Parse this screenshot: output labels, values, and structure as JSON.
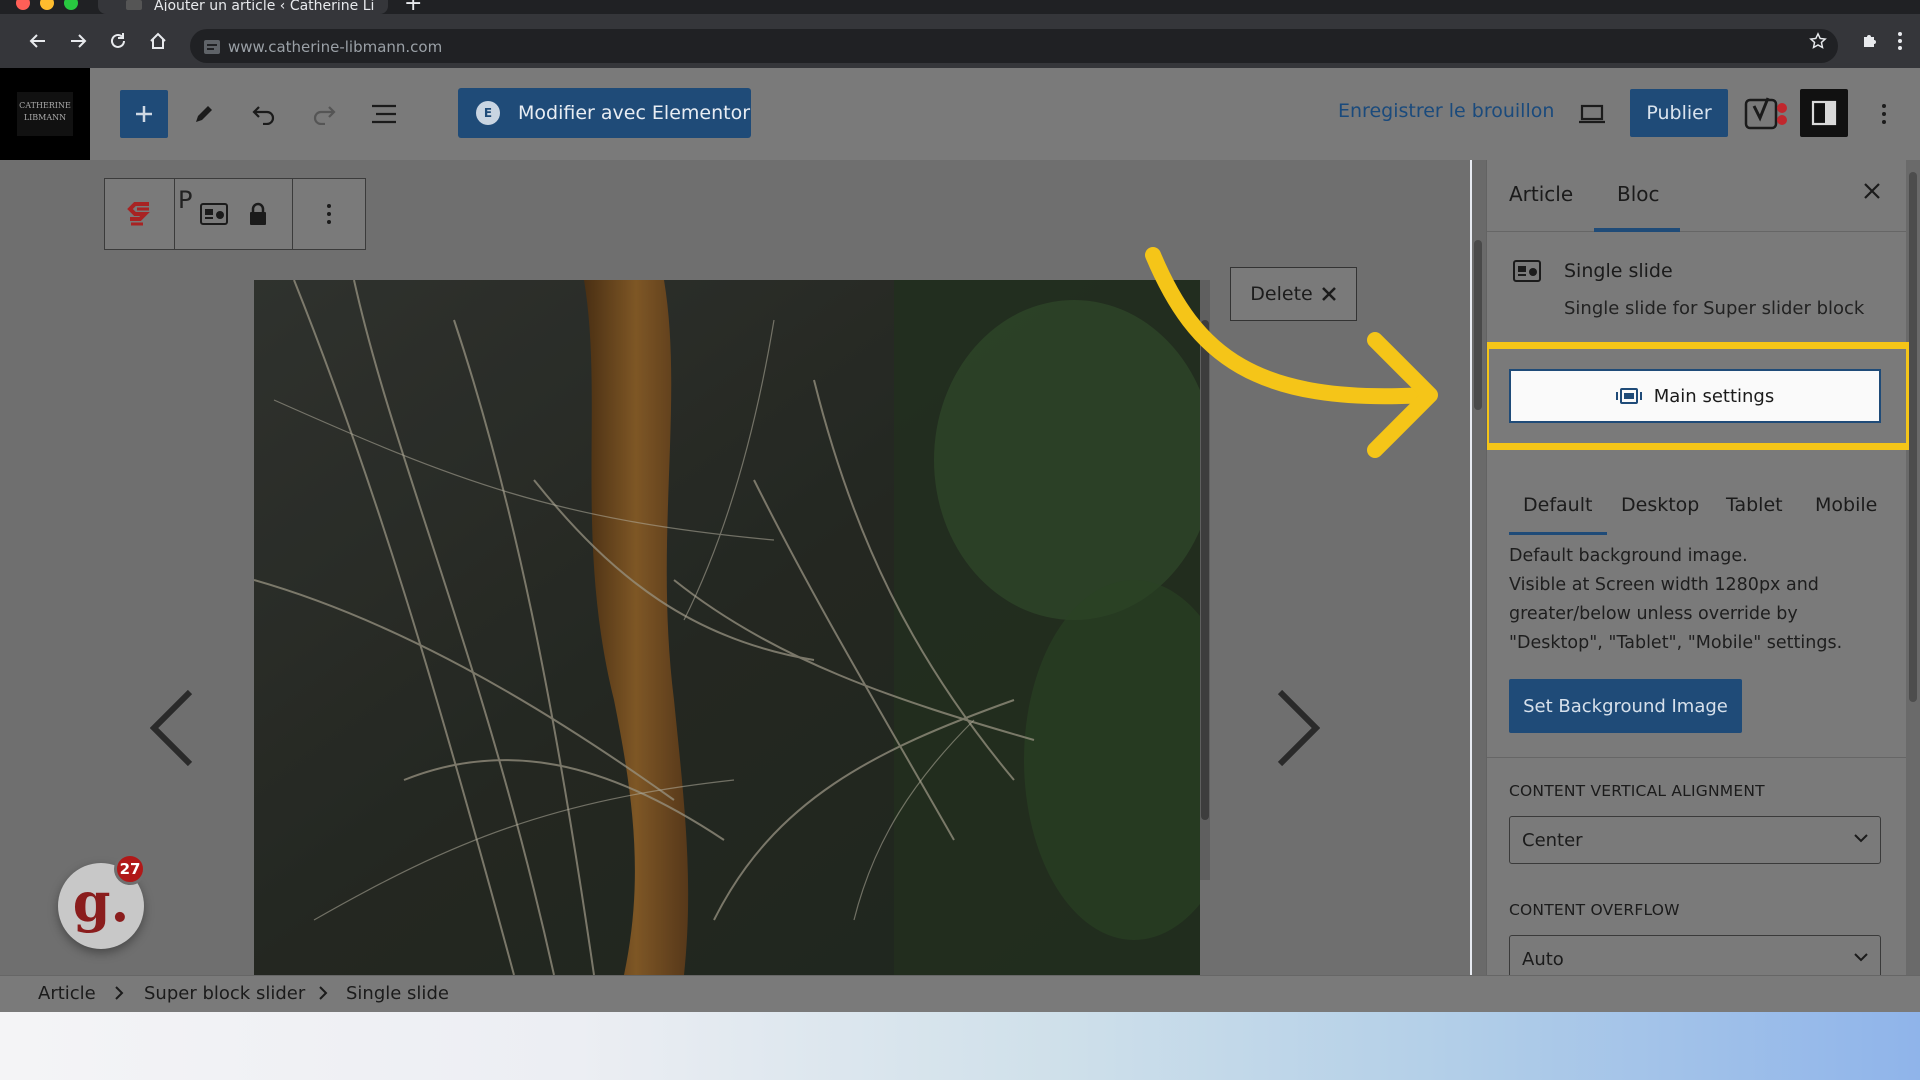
{
  "browser": {
    "tab_title": "Ajouter un article ‹ Catherine Libm",
    "url": "www.catherine-libmann.com"
  },
  "site_logo": {
    "line1": "CATHERINE",
    "line2": "LIBMANN"
  },
  "editor_toolbar": {
    "elementor_label": "Modifier avec Elementor",
    "elementor_badge": "E",
    "save_draft_label": "Enregistrer le brouillon",
    "publish_label": "Publier"
  },
  "block_toolbar": {
    "paragraph_letter": "P"
  },
  "canvas": {
    "delete_label": "Delete"
  },
  "notification_badge": {
    "letter": "g.",
    "count": "27"
  },
  "sidebar": {
    "tabs": [
      {
        "label": "Article"
      },
      {
        "label": "Bloc"
      }
    ],
    "active_tab": "Bloc",
    "block_title": "Single slide",
    "block_description": "Single slide for Super slider block",
    "main_settings_label": "Main settings",
    "responsive_tabs": [
      {
        "label": "Default"
      },
      {
        "label": "Desktop"
      },
      {
        "label": "Tablet"
      },
      {
        "label": "Mobile"
      }
    ],
    "active_responsive_tab": "Default",
    "help_text_1": "Default background image.",
    "help_text_2": "Visible at Screen width 1280px and greater/below unless override by \"Desktop\", \"Tablet\", \"Mobile\" settings.",
    "set_bg_label": "Set Background Image",
    "vertical_alignment": {
      "label": "CONTENT VERTICAL ALIGNMENT",
      "value": "Center"
    },
    "overflow": {
      "label": "CONTENT OVERFLOW",
      "value": "Auto"
    }
  },
  "breadcrumb": [
    {
      "label": "Article"
    },
    {
      "label": "Super block slider"
    },
    {
      "label": "Single slide"
    }
  ],
  "colors": {
    "accent": "#1f4b78",
    "highlight": "#f5c518",
    "overlay_gray": "#7a7a7a"
  }
}
